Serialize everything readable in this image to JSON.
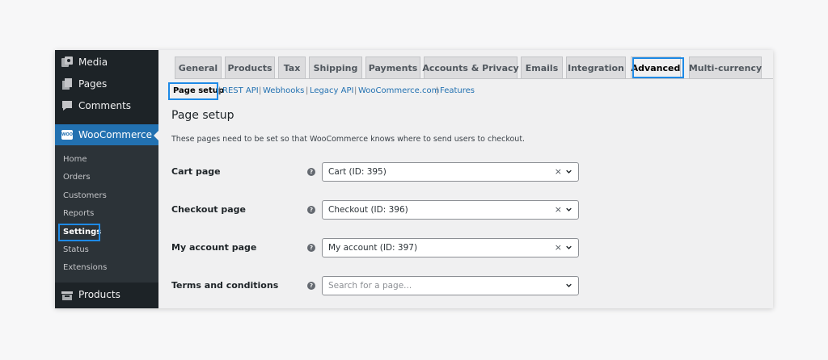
{
  "sidebar": {
    "top_items": [
      {
        "label": "Media",
        "icon": "media-icon"
      },
      {
        "label": "Pages",
        "icon": "pages-icon"
      },
      {
        "label": "Comments",
        "icon": "comments-icon"
      }
    ],
    "woocommerce": {
      "label": "WooCommerce",
      "logo_text": "WOO"
    },
    "submenu": [
      "Home",
      "Orders",
      "Customers",
      "Reports",
      "Settings",
      "Status",
      "Extensions"
    ],
    "current_submenu": "Settings",
    "products": {
      "label": "Products",
      "icon": "products-icon"
    }
  },
  "tabs": [
    "General",
    "Products",
    "Tax",
    "Shipping",
    "Payments",
    "Accounts & Privacy",
    "Emails",
    "Integration",
    "Advanced",
    "Multi-currency"
  ],
  "active_tab": "Advanced",
  "subsections": [
    "Page setup",
    "REST API",
    "Webhooks",
    "Legacy API",
    "WooCommerce.com",
    "Features"
  ],
  "current_subsection": "Page setup",
  "main": {
    "title": "Page setup",
    "description": "These pages need to be set so that WooCommerce knows where to send users to checkout.",
    "help_glyph": "?",
    "clear_glyph": "×",
    "rows": [
      {
        "label": "Cart page",
        "value": "Cart (ID: 395)",
        "placeholder": ""
      },
      {
        "label": "Checkout page",
        "value": "Checkout (ID: 396)",
        "placeholder": ""
      },
      {
        "label": "My account page",
        "value": "My account (ID: 397)",
        "placeholder": ""
      },
      {
        "label": "Terms and conditions",
        "value": "",
        "placeholder": "Search for a page..."
      }
    ]
  },
  "colors": {
    "sidebar_bg": "#1d2327",
    "submenu_bg": "#2c3338",
    "accent": "#2271b1",
    "highlight": "#1e8ae6"
  }
}
